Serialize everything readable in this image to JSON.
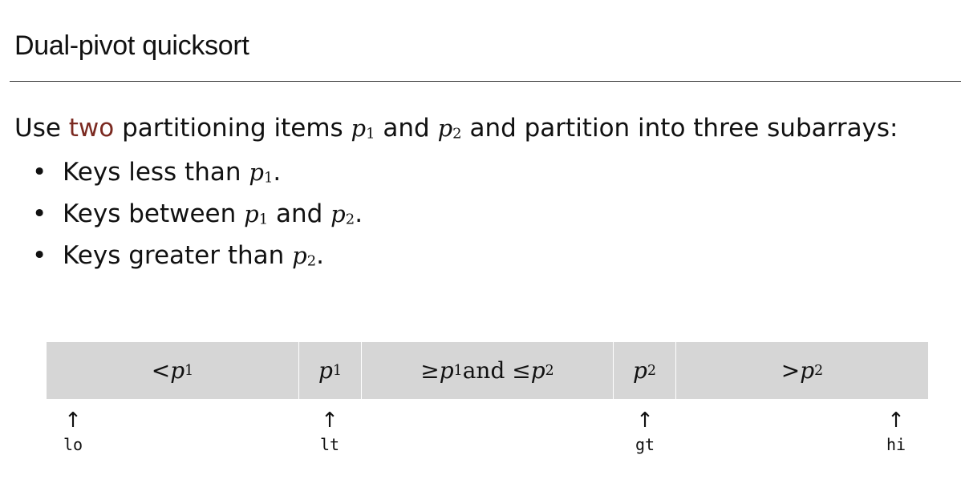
{
  "title": "Dual-pivot quicksort",
  "intro": {
    "prefix": "Use ",
    "accent_word": "two",
    "mid1": " partitioning items ",
    "p": "p",
    "sub1": "1",
    "and": " and ",
    "sub2": "2",
    "suffix": " and partition into three subarrays:"
  },
  "bullets": [
    {
      "text": "Keys less than ",
      "var": "p",
      "sub": "1",
      "end": "."
    },
    {
      "text": "Keys between ",
      "var": "p",
      "sub": "1",
      "mid": " and ",
      "var2": "p",
      "sub2": "2",
      "end": "."
    },
    {
      "text": "Keys greater than ",
      "var": "p",
      "sub": "2",
      "end": "."
    }
  ],
  "bullet_glyph": "•",
  "diagram": {
    "cells": [
      {
        "pre": "< ",
        "var": "p",
        "sub": "1"
      },
      {
        "var": "p",
        "sub": "1"
      },
      {
        "pre": "≥ ",
        "var": "p",
        "sub": "1",
        "mid": " and ≤ ",
        "var2": "p",
        "sub2": "2"
      },
      {
        "var": "p",
        "sub": "2"
      },
      {
        "pre": "> ",
        "var": "p",
        "sub": "2"
      }
    ],
    "markers": [
      {
        "arrow": "↑",
        "label": "lo"
      },
      {
        "arrow": "↑",
        "label": "lt"
      },
      {
        "arrow": "↑",
        "label": "gt"
      },
      {
        "arrow": "↑",
        "label": "hi"
      }
    ]
  },
  "colors": {
    "accent": "#7b2a21",
    "bar": "#d6d6d6",
    "rule": "#333333"
  }
}
